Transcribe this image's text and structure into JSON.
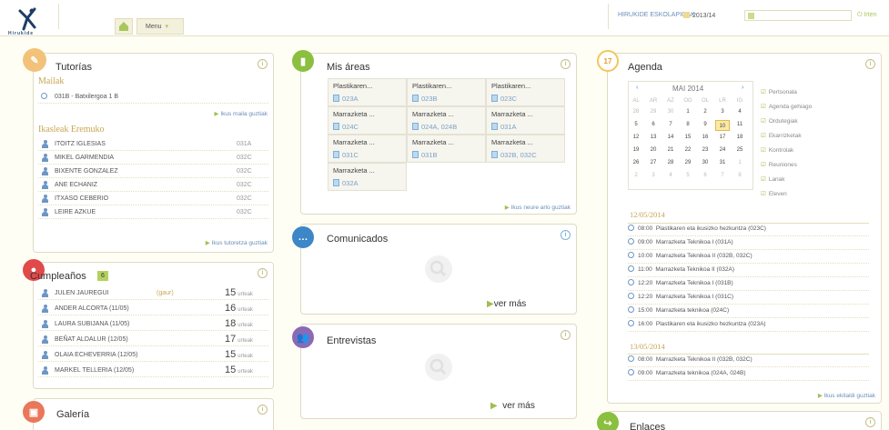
{
  "topbar": {
    "logo_text": "Hirukide",
    "menu_label": "Menu",
    "school": "HIRUKIDE ESKOLAPIOAK",
    "year": "2013/14",
    "logout": "Irten"
  },
  "tutorias": {
    "title": "Tutorías",
    "mailak_heading": "Mailak",
    "mailak_item": "031B - Batxilergoa 1 B",
    "see_all_mailak": "Ikus maila guztiak",
    "ikasleak_heading": "Ikasleak Eremuko",
    "students": [
      {
        "name": "ITOITZ IGLESIAS",
        "group": "031A"
      },
      {
        "name": "MIKEL GARMENDIA",
        "group": "032C"
      },
      {
        "name": "BIXENTE GONZALEZ",
        "group": "032C"
      },
      {
        "name": "ANE ECHANIZ",
        "group": "032C"
      },
      {
        "name": "ITXASO CEBERIO",
        "group": "032C"
      },
      {
        "name": "LEIRE AZKUE",
        "group": "032C"
      }
    ],
    "see_all_tutoretza": "Ikus tutoretza guztiak"
  },
  "cumpleanos": {
    "title": "Cumpleaños",
    "count": "6",
    "today": "(gaur)",
    "unit": "urteak",
    "people": [
      {
        "name": "JULEN JAUREGUI",
        "age": "15"
      },
      {
        "name": "ANDER ALCORTA (11/05)",
        "age": "16"
      },
      {
        "name": "LAURA SUBIJANA (11/05)",
        "age": "18"
      },
      {
        "name": "BEÑAT ALDALUR (12/05)",
        "age": "17"
      },
      {
        "name": "OLAIA ECHEVERRIA (12/05)",
        "age": "15"
      },
      {
        "name": "MARKEL TELLERIA (12/05)",
        "age": "15"
      }
    ]
  },
  "galeria": {
    "title": "Galería"
  },
  "areas": {
    "title": "Mis áreas",
    "cells": [
      {
        "name": "Plastikaren...",
        "code": "023A"
      },
      {
        "name": "Plastikaren...",
        "code": "023B"
      },
      {
        "name": "Plastikaren...",
        "code": "023C"
      },
      {
        "name": "Marrazketa ...",
        "code": "024C"
      },
      {
        "name": "Marrazketa ...",
        "code": "024A, 024B"
      },
      {
        "name": "Marrazketa ...",
        "code": "031A"
      },
      {
        "name": "Marrazketa ...",
        "code": "031C"
      },
      {
        "name": "Marrazketa ...",
        "code": "031B"
      },
      {
        "name": "Marrazketa ...",
        "code": "032B, 032C"
      },
      {
        "name": "Marrazketa ...",
        "code": "032A"
      }
    ],
    "see_all": "Ikus neure arlo guztiak"
  },
  "comunicados": {
    "title": "Comunicados",
    "more": "ver más"
  },
  "entrevistas": {
    "title": "Entrevistas",
    "more": "ver más"
  },
  "agenda": {
    "title": "Agenda",
    "month": "MAI 2014",
    "weekdays": [
      "AL",
      "AR",
      "AZ",
      "OG",
      "OL",
      "LR",
      "IG"
    ],
    "weeks": [
      [
        "28",
        "29",
        "30",
        "1",
        "2",
        "3",
        "4"
      ],
      [
        "5",
        "6",
        "7",
        "8",
        "9",
        "10",
        "11"
      ],
      [
        "12",
        "13",
        "14",
        "15",
        "16",
        "17",
        "18"
      ],
      [
        "19",
        "20",
        "21",
        "22",
        "23",
        "24",
        "25"
      ],
      [
        "26",
        "27",
        "28",
        "29",
        "30",
        "31",
        "1"
      ],
      [
        "2",
        "3",
        "4",
        "5",
        "6",
        "7",
        "8"
      ]
    ],
    "filters": [
      "Pertsonala",
      "Agenda gehiago",
      "Ordutegiak",
      "Ekarrizketak",
      "Kontrolak",
      "Reuniones",
      "Lanak",
      "Eleven"
    ],
    "day1": "12/05/2014",
    "events1": [
      {
        "time": "08:00",
        "text": "Plastikaren eta ikusizko hezkuntza (023C)"
      },
      {
        "time": "09:00",
        "text": "Marrazketa Teknikoa I (031A)"
      },
      {
        "time": "10:00",
        "text": "Marrazketa Teknikoa II (032B, 032C)"
      },
      {
        "time": "11:00",
        "text": "Marrazketa Teknikoa II (032A)"
      },
      {
        "time": "12:20",
        "text": "Marrazketa Teknikoa I (031B)"
      },
      {
        "time": "12:20",
        "text": "Marrazketa Teknikoa I (031C)"
      },
      {
        "time": "15:00",
        "text": "Marrazketa teknikoa (024C)"
      },
      {
        "time": "16:00",
        "text": "Plastikaren eta ikusizko hezkuntza (023A)"
      }
    ],
    "day2": "13/05/2014",
    "events2": [
      {
        "time": "08:00",
        "text": "Marrazketa Teknikoa II (032B, 032C)"
      },
      {
        "time": "09:00",
        "text": "Marrazketa teknikoa (024A, 024B)"
      }
    ],
    "see_all": "Ikus ekitaldi guztiak"
  },
  "enlaces": {
    "title": "Enlaces"
  }
}
